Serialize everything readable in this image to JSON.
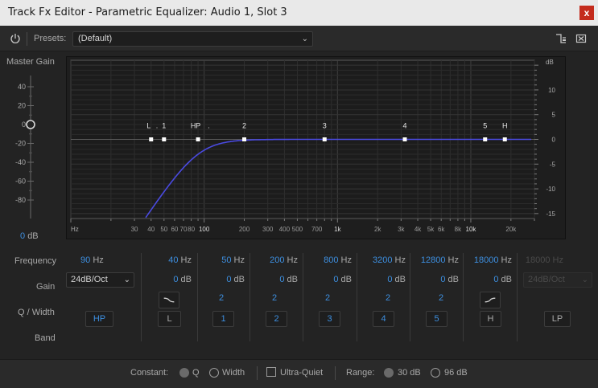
{
  "window": {
    "title": "Track Fx Editor - Parametric Equalizer: Audio 1, Slot 3",
    "close_glyph": "x"
  },
  "toolbar": {
    "presets_label": "Presets:",
    "preset_value": "(Default)"
  },
  "master_gain": {
    "label": "Master Gain",
    "ticks": [
      "40",
      "20",
      "0",
      "-20",
      "-40",
      "-60",
      "-80"
    ],
    "value": "0",
    "unit": "dB",
    "level": 0
  },
  "graph": {
    "db_axis": [
      "dB",
      "10",
      "5",
      "0",
      "-5",
      "-10",
      "-15"
    ],
    "freq_axis": [
      "Hz",
      "30",
      "40",
      "50",
      "60",
      "70",
      "80",
      "100",
      "200",
      "300",
      "400",
      "500",
      "700",
      "1k",
      "2k",
      "3k",
      "4k",
      "5k",
      "6k",
      "8k",
      "10k",
      "20k"
    ],
    "markers": [
      "L",
      "1",
      "HP",
      "2",
      "3",
      "4",
      "5",
      "H"
    ],
    "dot_label": "."
  },
  "rows": {
    "frequency": "Frequency",
    "gain": "Gain",
    "q_width": "Q / Width",
    "band": "Band"
  },
  "bands": {
    "hp": {
      "freq": "90",
      "freq_unit": "Hz",
      "slope": "24dB/Oct",
      "button": "HP"
    },
    "l": {
      "freq": "40",
      "freq_unit": "Hz",
      "gain": "0",
      "gain_unit": "dB",
      "button": "L"
    },
    "b1": {
      "freq": "50",
      "freq_unit": "Hz",
      "gain": "0",
      "gain_unit": "dB",
      "q": "2",
      "button": "1"
    },
    "b2": {
      "freq": "200",
      "freq_unit": "Hz",
      "gain": "0",
      "gain_unit": "dB",
      "q": "2",
      "button": "2"
    },
    "b3": {
      "freq": "800",
      "freq_unit": "Hz",
      "gain": "0",
      "gain_unit": "dB",
      "q": "2",
      "button": "3"
    },
    "b4": {
      "freq": "3200",
      "freq_unit": "Hz",
      "gain": "0",
      "gain_unit": "dB",
      "q": "2",
      "button": "4"
    },
    "b5": {
      "freq": "12800",
      "freq_unit": "Hz",
      "gain": "0",
      "gain_unit": "dB",
      "q": "2",
      "button": "5"
    },
    "h": {
      "freq": "18000",
      "freq_unit": "Hz",
      "gain": "0",
      "gain_unit": "dB",
      "button": "H"
    },
    "lp": {
      "freq": "18000",
      "freq_unit": "Hz",
      "slope": "24dB/Oct",
      "button": "LP"
    }
  },
  "footer": {
    "constant_label": "Constant:",
    "q_label": "Q",
    "width_label": "Width",
    "ultra_quiet_label": "Ultra-Quiet",
    "range_label": "Range:",
    "range_30": "30 dB",
    "range_96": "96 dB"
  },
  "colors": {
    "accent": "#3d8fe0",
    "curve": "#4a4ae0",
    "close": "#c42b1c"
  }
}
